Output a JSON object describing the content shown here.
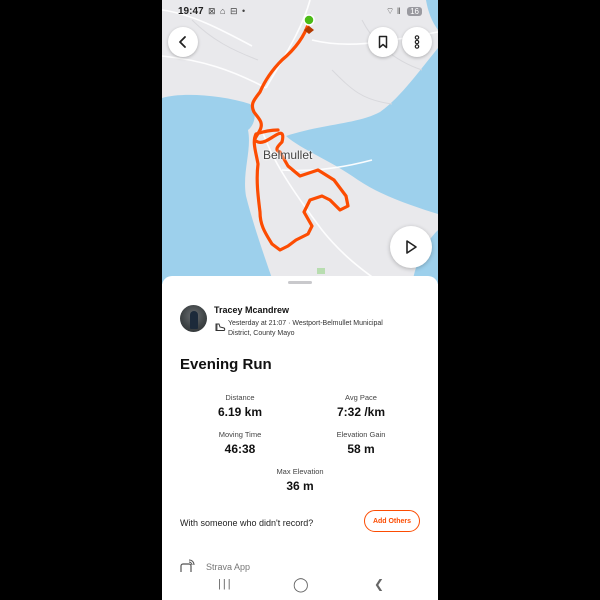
{
  "status_bar": {
    "time": "19:47",
    "notification_icons": "⊠ ⌂ ⊟ •",
    "signal": "⌔ ‖",
    "battery": "16"
  },
  "map": {
    "place_label": "Belmullet",
    "water_color": "#9dd0ec",
    "land_color": "#e9e9ec",
    "route_color": "#fc4c02",
    "start_marker_color": "#4cbb17"
  },
  "header_buttons": {
    "back_icon": "chevron-left-icon",
    "bookmark_icon": "bookmark-icon",
    "more_icon": "more-vertical-icon",
    "play_icon": "play-icon"
  },
  "activity": {
    "athlete": "Tracey Mcandrew",
    "meta": "Yesterday at 21:07 · Westport-Belmullet Municipal District, County Mayo",
    "title": "Evening Run"
  },
  "stats": [
    {
      "label": "Distance",
      "value": "6.19 km"
    },
    {
      "label": "Avg Pace",
      "value": "7:32 /km"
    },
    {
      "label": "Moving Time",
      "value": "46:38"
    },
    {
      "label": "Elevation Gain",
      "value": "58 m"
    },
    {
      "label": "Max Elevation",
      "value": "36 m"
    }
  ],
  "record_prompt": {
    "text": "With someone who didn't record?",
    "button": "Add Others"
  },
  "device": {
    "label": "Strava App"
  },
  "nav": {
    "recents": "|||",
    "home": "◯",
    "back": "❮"
  }
}
